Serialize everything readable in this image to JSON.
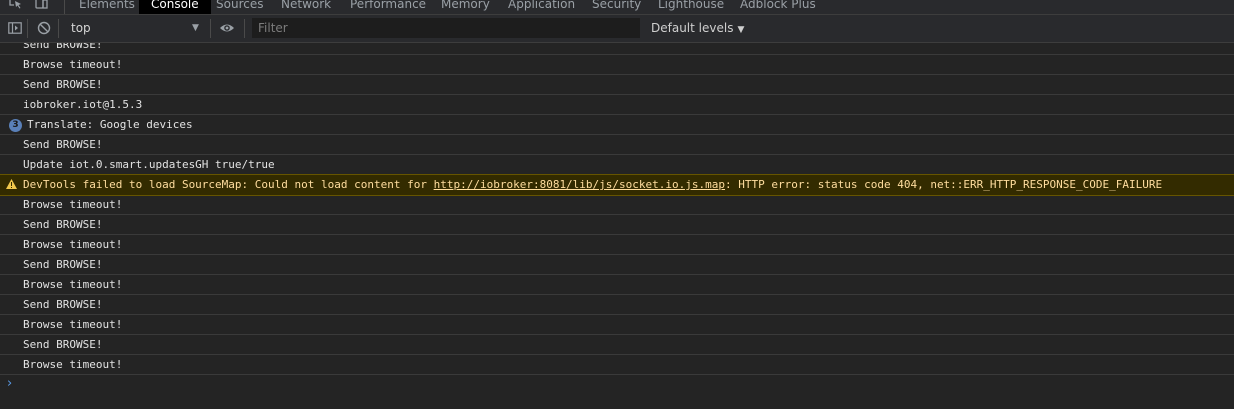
{
  "tabs": [
    {
      "label": "Elements",
      "active": false
    },
    {
      "label": "Console",
      "active": true
    },
    {
      "label": "Sources",
      "active": false
    },
    {
      "label": "Network",
      "active": false
    },
    {
      "label": "Performance",
      "active": false
    },
    {
      "label": "Memory",
      "active": false
    },
    {
      "label": "Application",
      "active": false
    },
    {
      "label": "Security",
      "active": false
    },
    {
      "label": "Lighthouse",
      "active": false
    },
    {
      "label": "Adblock Plus",
      "active": false
    }
  ],
  "toolbar": {
    "context": "top",
    "filter_placeholder": "Filter",
    "levels": "Default levels"
  },
  "messages": [
    {
      "text": "Send BROWSE!"
    },
    {
      "text": "Browse timeout!"
    },
    {
      "text": "Send BROWSE!"
    },
    {
      "text": "iobroker.iot@1.5.3"
    },
    {
      "text": "Translate: Google devices",
      "repeat_count": "3"
    },
    {
      "text": "Send BROWSE!"
    },
    {
      "text": "Update iot.0.smart.updatesGH true/true"
    },
    {
      "level": "warning",
      "prefix": "DevTools failed to load SourceMap: Could not load content for ",
      "link": "http://iobroker:8081/lib/js/socket.io.js.map",
      "suffix": ": HTTP error: status code 404, net::ERR_HTTP_RESPONSE_CODE_FAILURE"
    },
    {
      "text": "Browse timeout!"
    },
    {
      "text": "Send BROWSE!"
    },
    {
      "text": "Browse timeout!"
    },
    {
      "text": "Send BROWSE!"
    },
    {
      "text": "Browse timeout!"
    },
    {
      "text": "Send BROWSE!"
    },
    {
      "text": "Browse timeout!"
    },
    {
      "text": "Send BROWSE!"
    },
    {
      "text": "Browse timeout!"
    }
  ],
  "colors": {
    "background": "#242424",
    "toolbar": "#292a2d",
    "warning_bg": "#332b00",
    "warning_text": "#ffdd9e",
    "badge": "#5a80b8",
    "prompt": "#5a9be8"
  },
  "icons": {
    "inspect": "inspect-element-icon",
    "device": "device-toolbar-icon",
    "sidebar": "show-sidebar-icon",
    "clear": "clear-console-icon",
    "eye": "live-expression-eye-icon",
    "warning": "warning-icon",
    "prompt": "prompt-chevron-icon"
  }
}
